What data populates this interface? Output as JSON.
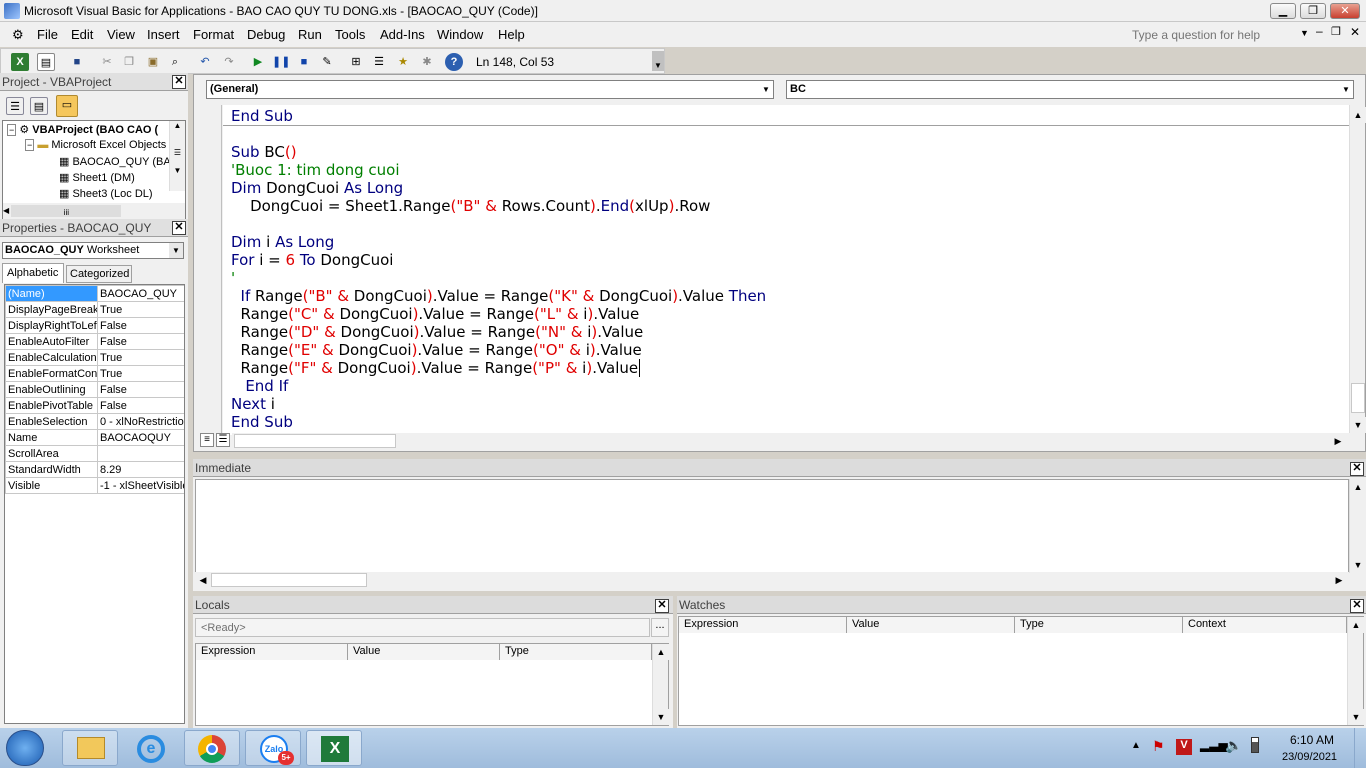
{
  "window": {
    "title": "Microsoft Visual Basic for Applications - BAO CAO QUY TU DONG.xls - [BAOCAO_QUY (Code)]"
  },
  "menu": {
    "items": [
      "File",
      "Edit",
      "View",
      "Insert",
      "Format",
      "Debug",
      "Run",
      "Tools",
      "Add-Ins",
      "Window",
      "Help"
    ],
    "help_placeholder": "Type a question for help"
  },
  "toolbar": {
    "position": "Ln 148, Col 53"
  },
  "project": {
    "title": "Project - VBAProject",
    "tree": [
      {
        "label": "VBAProject (BAO CAO (",
        "bold": true
      },
      {
        "label": "Microsoft Excel Objects"
      },
      {
        "label": "BAOCAO_QUY (BA"
      },
      {
        "label": "Sheet1 (DM)"
      },
      {
        "label": "Sheet3 (Loc DL)"
      }
    ]
  },
  "properties": {
    "title": "Properties - BAOCAO_QUY",
    "object_name": "BAOCAO_QUY",
    "object_type": "Worksheet",
    "tabs": [
      "Alphabetic",
      "Categorized"
    ],
    "rows": [
      [
        "(Name)",
        "BAOCAO_QUY"
      ],
      [
        "DisplayPageBreaks",
        "True"
      ],
      [
        "DisplayRightToLeft",
        "False"
      ],
      [
        "EnableAutoFilter",
        "False"
      ],
      [
        "EnableCalculation",
        "True"
      ],
      [
        "EnableFormatCond",
        "True"
      ],
      [
        "EnableOutlining",
        "False"
      ],
      [
        "EnablePivotTable",
        "False"
      ],
      [
        "EnableSelection",
        "0 - xlNoRestrictio"
      ],
      [
        "Name",
        "BAOCAOQUY"
      ],
      [
        "ScrollArea",
        ""
      ],
      [
        "StandardWidth",
        "8.29"
      ],
      [
        "Visible",
        "-1 - xlSheetVisible"
      ]
    ]
  },
  "code": {
    "object_combo": "(General)",
    "proc_combo": "BC",
    "lines": [
      "End Sub",
      "",
      "Sub BC()",
      "'Buoc 1: tim dong cuoi",
      "Dim DongCuoi As Long",
      "    DongCuoi = Sheet1.Range(\"B\" & Rows.Count).End(xlUp).Row",
      "",
      "Dim i As Long",
      "For i = 6 To DongCuoi",
      "'",
      "  If Range(\"B\" & DongCuoi).Value = Range(\"K\" & DongCuoi).Value Then",
      "  Range(\"C\" & DongCuoi).Value = Range(\"L\" & i).Value",
      "  Range(\"D\" & DongCuoi).Value = Range(\"N\" & i).Value",
      "  Range(\"E\" & DongCuoi).Value = Range(\"O\" & i).Value",
      "  Range(\"F\" & DongCuoi).Value = Range(\"P\" & i).Value",
      "   End If",
      "Next i",
      "End Sub"
    ]
  },
  "immediate": {
    "title": "Immediate"
  },
  "locals": {
    "title": "Locals",
    "status": "<Ready>",
    "columns": [
      "Expression",
      "Value",
      "Type"
    ]
  },
  "watches": {
    "title": "Watches",
    "columns": [
      "Expression",
      "Value",
      "Type",
      "Context"
    ]
  },
  "taskbar": {
    "time": "6:10 AM",
    "date": "23/09/2021",
    "zalo_badge": "5+"
  },
  "colors": {
    "keyword": "#00007f",
    "comment": "#007f00",
    "highlight": "#e00000",
    "selection": "#3399ff"
  }
}
